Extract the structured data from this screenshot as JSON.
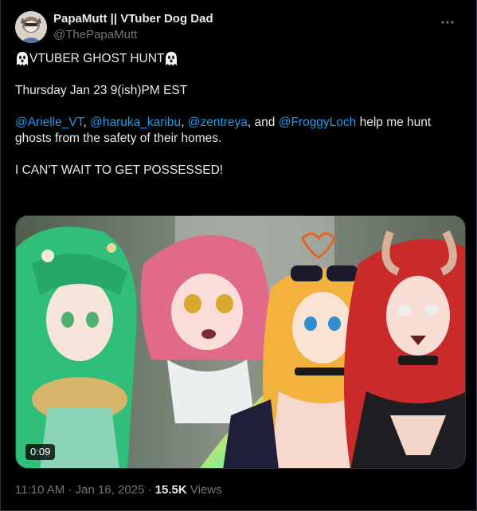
{
  "author": {
    "display_name": "PapaMutt || VTuber Dog Dad",
    "handle": "@ThePapaMutt"
  },
  "tweet": {
    "title": "VTUBER GHOST HUNT",
    "date_line": "Thursday Jan 23 9(ish)PM EST",
    "mentions": [
      "@Arielle_VT",
      "@haruka_karibu",
      "@zentreya",
      "@FroggyLoch"
    ],
    "sep1": ", ",
    "sep2": ", ",
    "sep3": ", and ",
    "tail": " help me hunt ghosts from the safety of their homes.",
    "closing": "I CAN'T WAIT TO GET POSSESSED!"
  },
  "media": {
    "duration": "0:09"
  },
  "meta": {
    "time": "11:10 AM",
    "separator": " · ",
    "date": "Jan 16, 2025",
    "views_count": "15.5K",
    "views_label": " Views"
  },
  "icons": {
    "more": "more-horizontal-icon",
    "ghost": "ghost-emoji-icon"
  },
  "colors": {
    "background": "#000000",
    "text": "#e7e9ea",
    "secondary": "#71767b",
    "link": "#1d9bf0"
  }
}
